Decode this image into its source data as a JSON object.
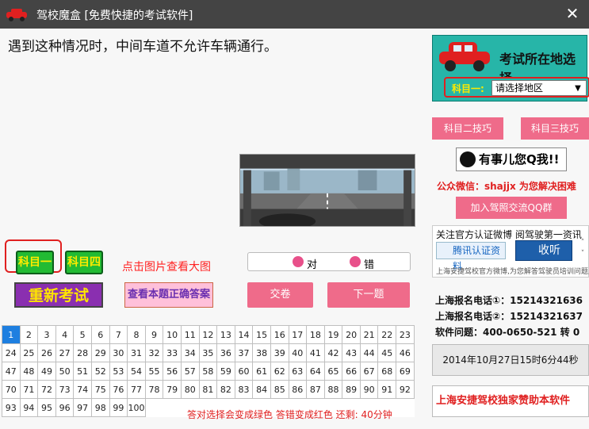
{
  "window": {
    "title": "驾校魔盒 [免费快捷的考试软件]",
    "close_label": "✕"
  },
  "question": {
    "text": "遇到这种情况时，中间车道不允许车辆通行。"
  },
  "subjects": {
    "subject1_label": "科目一",
    "subject4_label": "科目四"
  },
  "hint_link": "点击图片查看大图",
  "buttons": {
    "retest_label": "重新考试",
    "show_answer_label": "查看本题正确答案",
    "submit_label": "交卷",
    "next_label": "下一题"
  },
  "answers": {
    "right_label": "对",
    "wrong_label": "错"
  },
  "question_grid": [
    [
      1,
      2,
      3,
      4,
      5,
      6,
      7,
      8,
      9,
      10,
      11,
      12,
      13,
      14,
      15,
      16,
      17,
      18,
      19,
      20,
      21,
      22,
      23
    ],
    [
      24,
      25,
      26,
      27,
      28,
      29,
      30,
      31,
      32,
      33,
      34,
      35,
      36,
      37,
      38,
      39,
      40,
      41,
      42,
      43,
      44,
      45,
      46
    ],
    [
      47,
      48,
      49,
      50,
      51,
      52,
      53,
      54,
      55,
      56,
      57,
      58,
      59,
      60,
      61,
      62,
      63,
      64,
      65,
      66,
      67,
      68,
      69
    ],
    [
      70,
      71,
      72,
      73,
      74,
      75,
      76,
      77,
      78,
      79,
      80,
      81,
      82,
      83,
      84,
      85,
      86,
      87,
      88,
      89,
      90,
      91,
      92
    ],
    [
      93,
      94,
      95,
      96,
      97,
      98,
      99,
      100
    ]
  ],
  "active_question": 1,
  "footer_note": "答对选择会变成绿色  答错变成红色   还剩: 40分钟",
  "sidebar": {
    "region_title": "考试所在地选择",
    "region_select_label": "科目一:",
    "region_select_value": "请选择地区",
    "tip2_label": "科目二技巧",
    "tip3_label": "科目三技巧",
    "qq_label": "有事儿您Q我!!",
    "wechat_text": "公众微信：shajjx  为您解决困难",
    "join_qq_label": "加入驾照交流QQ群",
    "weibo_title": "关注官方认证微博  阅驾驶第一资讯",
    "weibo_verify_label": "腾讯认证资料",
    "weibo_follow_label": "收听",
    "weibo_footer": "上海安捷驾校官方微博,为您解答驾驶员培训问题,",
    "phone1": "上海报名电话①：15214321636",
    "phone2": "上海报名电话②：15214321637",
    "software_issue": "软件问题：400-0650-521 转 0",
    "datetime": "2014年10月27日15时6分44秒",
    "sponsor": "上海安捷驾校独家赞助本软件"
  },
  "colors": {
    "titlebar": "#444444",
    "accent_pink": "#ef6b8a",
    "subject_green": "#22bb33",
    "highlight_red": "#e02020",
    "grid_active": "#1e7fe0",
    "region_teal": "#27b5a8"
  }
}
